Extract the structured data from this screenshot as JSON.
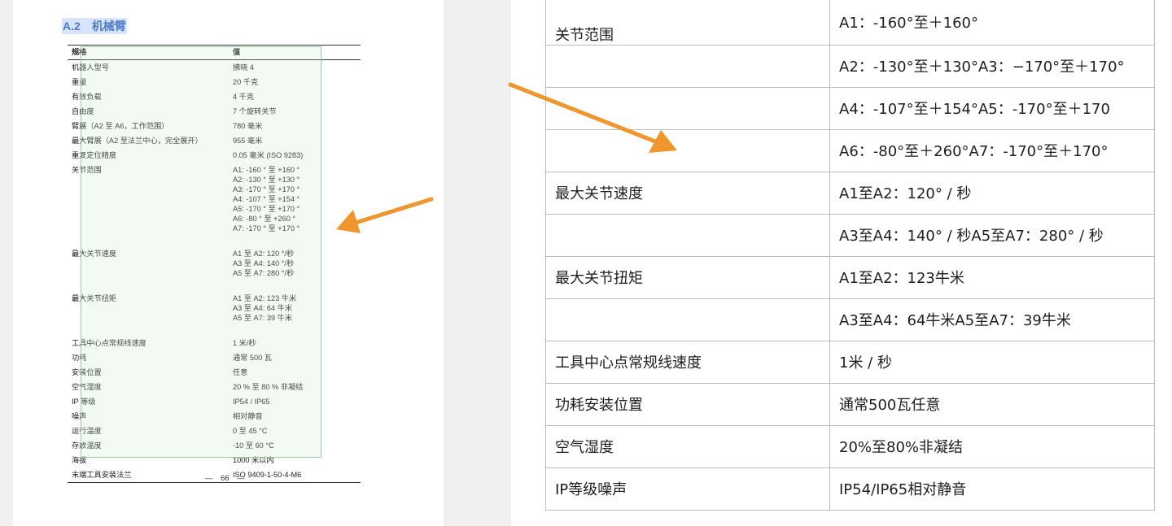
{
  "left_doc": {
    "section_title": "A.2　机械臂",
    "header": {
      "spec": "规格",
      "value": "值"
    },
    "rows": [
      {
        "spec": "机器人型号",
        "value": [
          "拂晓 4"
        ]
      },
      {
        "spec": "重量",
        "value": [
          "20 千克"
        ]
      },
      {
        "spec": "有效负载",
        "value": [
          "4 千克"
        ]
      },
      {
        "spec": "自由度",
        "value": [
          "7 个旋转关节"
        ]
      },
      {
        "spec": "臂展（A2 至 A6，工作范围）",
        "value": [
          "780 毫米"
        ]
      },
      {
        "spec": "最大臂展（A2 至法兰中心，完全展开）",
        "value": [
          "955 毫米"
        ]
      },
      {
        "spec": "重复定位精度",
        "value": [
          "0.05 毫米 (ISO 9283)"
        ]
      },
      {
        "spec": "关节范围",
        "value": [
          "A1: -160 ° 至 +160 °",
          "A2: -130 ° 至 +130 °",
          "A3: -170 ° 至 +170 °",
          "A4: -107 ° 至 +154 °",
          "A5: -170 ° 至 +170 °",
          "A6: -80 ° 至 +260 °",
          "A7: -170 ° 至 +170 °"
        ]
      },
      {
        "spec": "最大关节速度",
        "value": [
          "A1 至 A2: 120 °/秒",
          "A3 至 A4: 140 °/秒",
          "A5 至 A7: 280 °/秒"
        ]
      },
      {
        "spec": "最大关节扭矩",
        "value": [
          "A1 至 A2: 123 牛米",
          "A3 至 A4: 64 牛米",
          "A5 至 A7: 39 牛米"
        ]
      },
      {
        "spec": "工具中心点常规线速度",
        "value": [
          "1 米/秒"
        ]
      },
      {
        "spec": "功耗",
        "value": [
          "通常 500 瓦"
        ]
      },
      {
        "spec": "安装位置",
        "value": [
          "任意"
        ]
      },
      {
        "spec": "空气湿度",
        "value": [
          "20 % 至 80 % 非凝结"
        ]
      },
      {
        "spec": "IP 等级",
        "value": [
          "IP54 / IP65"
        ]
      },
      {
        "spec": "噪声",
        "value": [
          "相对静音"
        ]
      },
      {
        "spec": "运行温度",
        "value": [
          "0 至 45 °C"
        ]
      },
      {
        "spec": "存放温度",
        "value": [
          "-10 至 60 °C"
        ]
      },
      {
        "spec": "海拔",
        "value": [
          "1000 米以内"
        ]
      },
      {
        "spec": "末端工具安装法兰",
        "value": [
          "ISO 9409-1-50-4-M6"
        ]
      }
    ],
    "page_number": "—　66　—"
  },
  "right_table": {
    "rows": [
      {
        "key": "关节范围",
        "value": "A1：-160°至＋160°"
      },
      {
        "key": "",
        "value": "A2：-130°至＋130°A3：−170°至＋170°"
      },
      {
        "key": "",
        "value": "A4：-107°至＋154°A5：-170°至＋170"
      },
      {
        "key": "",
        "value": "A6：-80°至＋260°A7：-170°至＋170°"
      },
      {
        "key": "最大关节速度",
        "value": "A1至A2：120° / 秒"
      },
      {
        "key": "",
        "value": "A3至A4：140° / 秒A5至A7：280° / 秒"
      },
      {
        "key": "最大关节扭矩",
        "value": "A1至A2：123牛米"
      },
      {
        "key": "",
        "value": "A3至A4：64牛米A5至A7：39牛米"
      },
      {
        "key": "工具中心点常规线速度",
        "value": "1米 / 秒"
      },
      {
        "key": "功耗安装位置",
        "value": "通常500瓦任意"
      },
      {
        "key": "空气湿度",
        "value": "20%至80%非凝结"
      },
      {
        "key": "IP等级噪声",
        "value": "IP54/IP65相对静音"
      }
    ]
  },
  "colors": {
    "arrow": "#f0962e",
    "highlight_border": "#9fc9a3",
    "title": "#4f7cc7"
  }
}
